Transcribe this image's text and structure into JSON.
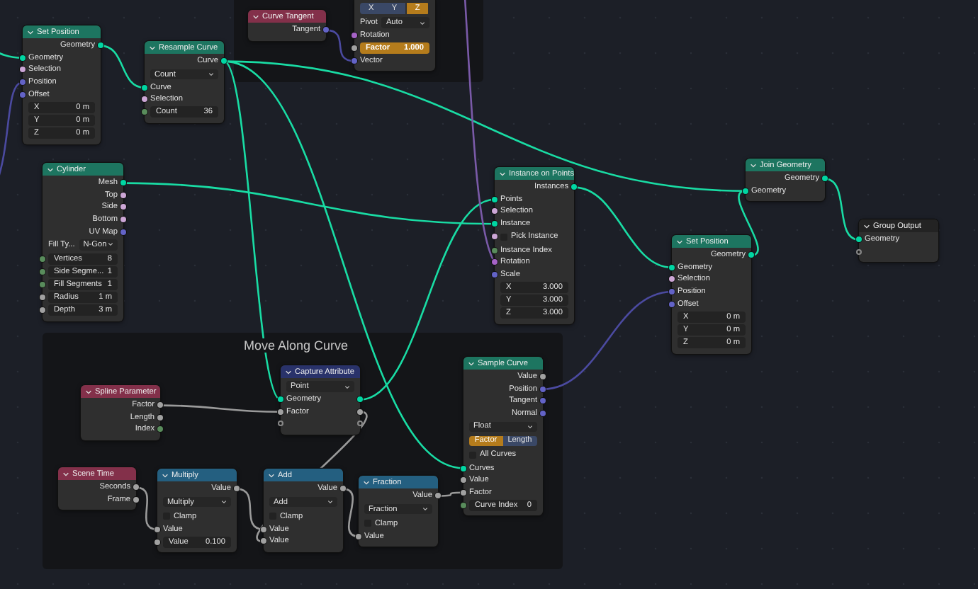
{
  "frames": [
    {
      "label": "Move Along Curve"
    }
  ],
  "nodes": [
    {
      "title": "Set Position",
      "kind": "geometry",
      "rows": [
        {
          "kind": "out",
          "label": "Geometry",
          "color": "#00d6a3"
        },
        {
          "kind": "in",
          "label": "Geometry",
          "color": "#00d6a3"
        },
        {
          "kind": "in",
          "label": "Selection",
          "color": "#cca6d6"
        },
        {
          "kind": "in",
          "label": "Position",
          "color": "#6363c7"
        },
        {
          "kind": "in",
          "label": "Offset",
          "color": "#6363c7"
        },
        {
          "kind": "field",
          "label": "X",
          "value": "0 m"
        },
        {
          "kind": "field",
          "label": "Y",
          "value": "0 m"
        },
        {
          "kind": "field",
          "label": "Z",
          "value": "0 m"
        }
      ]
    },
    {
      "title": "Curve Tangent",
      "kind": "input",
      "rows": [
        {
          "kind": "out",
          "label": "Tangent",
          "color": "#6363c7"
        }
      ]
    },
    {
      "rows": [
        {
          "kind": "toggle",
          "options": [
            {
              "label": "X",
              "selected": false
            },
            {
              "label": "Y",
              "selected": false
            },
            {
              "label": "Z",
              "selected": true
            }
          ]
        },
        {
          "kind": "dropdown",
          "label": "Pivot",
          "value": "Auto"
        },
        {
          "kind": "in",
          "label": "Rotation",
          "color": "#a663c7"
        },
        {
          "kind": "field",
          "label": "Factor",
          "value": "1.000",
          "color": "#a1a1a1",
          "keyed": true
        },
        {
          "kind": "in",
          "label": "Vector",
          "color": "#6363c7"
        }
      ]
    },
    {
      "title": "Resample Curve",
      "kind": "geometry",
      "rows": [
        {
          "kind": "out",
          "label": "Curve",
          "color": "#00d6a3"
        },
        {
          "kind": "dropdown",
          "value": "Count"
        },
        {
          "kind": "in",
          "label": "Curve",
          "color": "#00d6a3"
        },
        {
          "kind": "in",
          "label": "Selection",
          "color": "#cca6d6"
        },
        {
          "kind": "field",
          "label": "Count",
          "value": "36",
          "color": "#598c5c"
        }
      ]
    },
    {
      "title": "Cylinder",
      "kind": "geometry",
      "rows": [
        {
          "kind": "out",
          "label": "Mesh",
          "color": "#00d6a3"
        },
        {
          "kind": "out",
          "label": "Top",
          "color": "#cca6d6"
        },
        {
          "kind": "out",
          "label": "Side",
          "color": "#cca6d6"
        },
        {
          "kind": "out",
          "label": "Bottom",
          "color": "#cca6d6"
        },
        {
          "kind": "out",
          "label": "UV Map",
          "color": "#6363c7"
        },
        {
          "kind": "dropdown",
          "label": "Fill Ty...",
          "value": "N-Gon"
        },
        {
          "kind": "field",
          "label": "Vertices",
          "value": "8",
          "color": "#598c5c"
        },
        {
          "kind": "field",
          "label": "Side Segme...",
          "value": "1",
          "color": "#598c5c"
        },
        {
          "kind": "field",
          "label": "Fill Segments",
          "value": "1",
          "color": "#598c5c"
        },
        {
          "kind": "field",
          "label": "Radius",
          "value": "1 m",
          "color": "#a1a1a1"
        },
        {
          "kind": "field",
          "label": "Depth",
          "value": "3 m",
          "color": "#a1a1a1"
        }
      ]
    },
    {
      "title": "Join Geometry",
      "kind": "geometry",
      "rows": [
        {
          "kind": "out",
          "label": "Geometry",
          "color": "#00d6a3"
        },
        {
          "kind": "in",
          "label": "Geometry",
          "color": "#00d6a3"
        }
      ]
    },
    {
      "title": "Instance on Points",
      "kind": "geometry",
      "rows": [
        {
          "kind": "out",
          "label": "Instances",
          "color": "#00d6a3"
        },
        {
          "kind": "in",
          "label": "Points",
          "color": "#00d6a3"
        },
        {
          "kind": "in",
          "label": "Selection",
          "color": "#cca6d6"
        },
        {
          "kind": "in",
          "label": "Instance",
          "color": "#00d6a3"
        },
        {
          "kind": "check",
          "label": "Pick Instance",
          "checked": false,
          "color": "#cca6d6"
        },
        {
          "kind": "in",
          "label": "Instance Index",
          "color": "#598c5c"
        },
        {
          "kind": "in",
          "label": "Rotation",
          "color": "#a663c7"
        },
        {
          "kind": "in",
          "label": "Scale",
          "color": "#6363c7"
        },
        {
          "kind": "field",
          "label": "X",
          "value": "3.000"
        },
        {
          "kind": "field",
          "label": "Y",
          "value": "3.000"
        },
        {
          "kind": "field",
          "label": "Z",
          "value": "3.000"
        }
      ]
    },
    {
      "title": "Group Output",
      "kind": "output",
      "rows": [
        {
          "kind": "in",
          "label": "Geometry",
          "color": "#00d6a3"
        },
        {
          "kind": "empty"
        }
      ]
    },
    {
      "title": "Set Position",
      "kind": "geometry",
      "rows": [
        {
          "kind": "out",
          "label": "Geometry",
          "color": "#00d6a3"
        },
        {
          "kind": "in",
          "label": "Geometry",
          "color": "#00d6a3"
        },
        {
          "kind": "in",
          "label": "Selection",
          "color": "#cca6d6"
        },
        {
          "kind": "in",
          "label": "Position",
          "color": "#6363c7"
        },
        {
          "kind": "in",
          "label": "Offset",
          "color": "#6363c7"
        },
        {
          "kind": "field",
          "label": "X",
          "value": "0 m"
        },
        {
          "kind": "field",
          "label": "Y",
          "value": "0 m"
        },
        {
          "kind": "field",
          "label": "Z",
          "value": "0 m"
        }
      ]
    },
    {
      "title": "Capture Attribute",
      "kind": "attribute",
      "rows": [
        {
          "kind": "dropdown",
          "value": "Point"
        },
        {
          "kind": "both",
          "label": "Geometry",
          "color": "#00d6a3"
        },
        {
          "kind": "both",
          "label": "Factor",
          "color": "#a1a1a1"
        },
        {
          "kind": "empty",
          "both": true
        }
      ]
    },
    {
      "title": "Sample Curve",
      "kind": "geometry",
      "rows": [
        {
          "kind": "out",
          "label": "Value",
          "color": "#a1a1a1"
        },
        {
          "kind": "out",
          "label": "Position",
          "color": "#6363c7"
        },
        {
          "kind": "out",
          "label": "Tangent",
          "color": "#6363c7"
        },
        {
          "kind": "out",
          "label": "Normal",
          "color": "#6363c7"
        },
        {
          "kind": "dropdown",
          "value": "Float"
        },
        {
          "kind": "toggle",
          "options": [
            {
              "label": "Factor",
              "selected": true
            },
            {
              "label": "Length",
              "selected": false
            }
          ]
        },
        {
          "kind": "check",
          "label": "All Curves",
          "checked": false
        },
        {
          "kind": "in",
          "label": "Curves",
          "color": "#00d6a3"
        },
        {
          "kind": "in",
          "label": "Value",
          "color": "#a1a1a1"
        },
        {
          "kind": "in",
          "label": "Factor",
          "color": "#a1a1a1"
        },
        {
          "kind": "field",
          "label": "Curve Index",
          "value": "0",
          "color": "#598c5c"
        }
      ]
    },
    {
      "title": "Spline Parameter",
      "kind": "input",
      "rows": [
        {
          "kind": "out",
          "label": "Factor",
          "color": "#a1a1a1"
        },
        {
          "kind": "out",
          "label": "Length",
          "color": "#a1a1a1"
        },
        {
          "kind": "out",
          "label": "Index",
          "color": "#598c5c"
        }
      ]
    },
    {
      "title": "Scene Time",
      "kind": "input",
      "rows": [
        {
          "kind": "out",
          "label": "Seconds",
          "color": "#a1a1a1"
        },
        {
          "kind": "out",
          "label": "Frame",
          "color": "#a1a1a1"
        }
      ]
    },
    {
      "title": "Multiply",
      "kind": "converter",
      "rows": [
        {
          "kind": "out",
          "label": "Value",
          "color": "#a1a1a1"
        },
        {
          "kind": "dropdown",
          "value": "Multiply"
        },
        {
          "kind": "check",
          "label": "Clamp",
          "checked": false
        },
        {
          "kind": "in",
          "label": "Value",
          "color": "#a1a1a1"
        },
        {
          "kind": "field",
          "label": "Value",
          "value": "0.100",
          "color": "#a1a1a1"
        }
      ]
    },
    {
      "title": "Add",
      "kind": "converter",
      "rows": [
        {
          "kind": "out",
          "label": "Value",
          "color": "#a1a1a1"
        },
        {
          "kind": "dropdown",
          "value": "Add"
        },
        {
          "kind": "check",
          "label": "Clamp",
          "checked": false
        },
        {
          "kind": "in",
          "label": "Value",
          "color": "#a1a1a1"
        },
        {
          "kind": "in",
          "label": "Value",
          "color": "#a1a1a1"
        }
      ]
    },
    {
      "title": "Fraction",
      "kind": "converter",
      "rows": [
        {
          "kind": "out",
          "label": "Value",
          "color": "#a1a1a1"
        },
        {
          "kind": "dropdown",
          "value": "Fraction"
        },
        {
          "kind": "check",
          "label": "Clamp",
          "checked": false
        },
        {
          "kind": "in",
          "label": "Value",
          "color": "#a1a1a1"
        }
      ]
    }
  ]
}
